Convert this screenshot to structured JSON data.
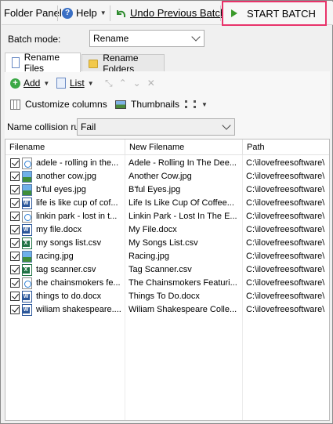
{
  "toolbar": {
    "folder_panel": "Folder Panel",
    "help": "Help",
    "undo": "Undo Previous Batch",
    "start": "START BATCH"
  },
  "batch_mode": {
    "label": "Batch mode:",
    "value": "Rename"
  },
  "tabs": [
    {
      "label": "Rename Files",
      "icon": "file-icon",
      "active": true
    },
    {
      "label": "Rename Folders",
      "icon": "folder-icon",
      "active": false
    }
  ],
  "tools": {
    "add": "Add",
    "list": "List",
    "customize": "Customize columns",
    "thumbnails": "Thumbnails"
  },
  "collision": {
    "label": "Name collision rule:",
    "value": "Fail"
  },
  "table": {
    "columns": [
      "Filename",
      "New Filename",
      "Path"
    ],
    "rows": [
      {
        "type": "mp3",
        "filename": "adele - rolling in the...",
        "new_filename": "Adele - Rolling In The Dee...",
        "path": "C:\\ilovefreesoftware\\",
        "checked": true
      },
      {
        "type": "jpg",
        "filename": "another cow.jpg",
        "new_filename": "Another Cow.jpg",
        "path": "C:\\ilovefreesoftware\\",
        "checked": true
      },
      {
        "type": "jpg",
        "filename": "b'ful eyes.jpg",
        "new_filename": "B'ful Eyes.jpg",
        "path": "C:\\ilovefreesoftware\\",
        "checked": true
      },
      {
        "type": "docx",
        "filename": "life is like cup of cof...",
        "new_filename": "Life Is Like Cup Of Coffee...",
        "path": "C:\\ilovefreesoftware\\",
        "checked": true
      },
      {
        "type": "mp3",
        "filename": "linkin park - lost in t...",
        "new_filename": "Linkin Park - Lost In The E...",
        "path": "C:\\ilovefreesoftware\\",
        "checked": true
      },
      {
        "type": "docx",
        "filename": "my file.docx",
        "new_filename": "My File.docx",
        "path": "C:\\ilovefreesoftware\\",
        "checked": true
      },
      {
        "type": "csv",
        "filename": "my songs list.csv",
        "new_filename": "My Songs List.csv",
        "path": "C:\\ilovefreesoftware\\",
        "checked": true
      },
      {
        "type": "jpg",
        "filename": "racing.jpg",
        "new_filename": "Racing.jpg",
        "path": "C:\\ilovefreesoftware\\",
        "checked": true
      },
      {
        "type": "csv",
        "filename": "tag scanner.csv",
        "new_filename": "Tag Scanner.csv",
        "path": "C:\\ilovefreesoftware\\",
        "checked": true
      },
      {
        "type": "mp3",
        "filename": "the chainsmokers fe...",
        "new_filename": "The Chainsmokers Featuri...",
        "path": "C:\\ilovefreesoftware\\",
        "checked": true
      },
      {
        "type": "docx",
        "filename": "things to do.docx",
        "new_filename": "Things To Do.docx",
        "path": "C:\\ilovefreesoftware\\",
        "checked": true
      },
      {
        "type": "docx",
        "filename": "wiliam shakespeare....",
        "new_filename": "Wiliam Shakespeare Colle...",
        "path": "C:\\ilovefreesoftware\\",
        "checked": true
      }
    ]
  },
  "colors": {
    "highlight": "#e8336a",
    "accent": "#3a9a2a"
  }
}
